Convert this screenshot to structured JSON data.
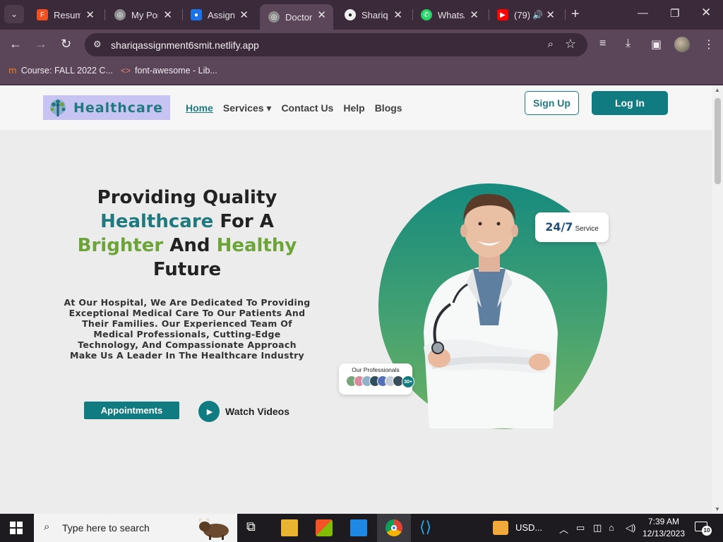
{
  "browser": {
    "tabs": [
      {
        "label": "Resume",
        "icon": "figma-icon",
        "color": "#f24e1e"
      },
      {
        "label": "My Portfolio",
        "icon": "globe-icon",
        "color": "#8d8d8d"
      },
      {
        "label": "Assignment",
        "icon": "classroom-icon",
        "color": "#1a73e8"
      },
      {
        "label": "Doctor",
        "icon": "globe-icon",
        "color": "#8d8d8d"
      },
      {
        "label": "ShariqS",
        "icon": "github-icon",
        "color": "#222222"
      },
      {
        "label": "WhatsApp",
        "icon": "whatsapp-icon",
        "color": "#25d366"
      },
      {
        "label": "(79)",
        "icon": "youtube-icon",
        "color": "#ff0000"
      }
    ],
    "active_tab_index": 3,
    "url": "shariqassignment6smit.netlify.app",
    "bookmarks": [
      {
        "label": "Course: FALL 2022 C...",
        "icon": "moodle-icon"
      },
      {
        "label": "font-awesome - Lib...",
        "icon": "code-icon"
      }
    ]
  },
  "site": {
    "logo_text": "Healthcare",
    "nav": [
      {
        "label": "Home",
        "active": true
      },
      {
        "label": "Services ▾",
        "active": false
      },
      {
        "label": "Contact Us",
        "active": false
      },
      {
        "label": "Help",
        "active": false
      },
      {
        "label": "Blogs",
        "active": false
      }
    ],
    "signup_label": "Sign Up",
    "login_label": "Log In",
    "hero": {
      "title_1": "Providing Quality",
      "title_2a": "Healthcare",
      "title_2b": " For A",
      "title_3a": "Brighter",
      "title_3b": " And ",
      "title_3c": "Healthy",
      "title_4": "Future",
      "description": "At Our Hospital, We Are Dedicated To Providing Exceptional Medical Care To Our Patients And Their Families. Our Experienced Team Of Medical Professionals, Cutting-Edge Technology, And Compassionate Approach Make Us A Leader In The Healthcare Industry",
      "appointments_label": "Appointments",
      "watch_label": "Watch Videos",
      "badge_num": "24/7",
      "badge_text": "Service",
      "pro_title": "Our Professionals",
      "pro_count": "30+"
    }
  },
  "taskbar": {
    "search_placeholder": "Type here to search",
    "currency_label": "USD...",
    "time": "7:39 AM",
    "date": "12/13/2023",
    "notifications": "10"
  },
  "colors": {
    "brand_teal": "#117b82",
    "brand_green": "#6ca43a",
    "chrome_bg": "#5a4559"
  }
}
